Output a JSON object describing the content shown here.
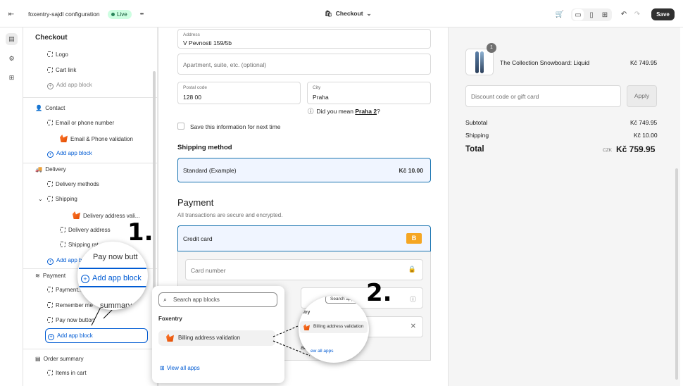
{
  "topbar": {
    "store_name": "foxentry-sajdl configuration",
    "status_badge": "Live",
    "more": "•••",
    "page_selector": "Checkout",
    "save_label": "Save"
  },
  "sidebar": {
    "title": "Checkout",
    "header_items": [
      {
        "label": "Logo"
      },
      {
        "label": "Cart link"
      },
      {
        "label": "Add app block"
      }
    ],
    "contact": {
      "title": "Contact",
      "items": [
        {
          "label": "Email or phone number"
        },
        {
          "label": "Email & Phone validation"
        },
        {
          "label": "Add app block"
        }
      ]
    },
    "delivery": {
      "title": "Delivery",
      "items": [
        {
          "label": "Delivery methods"
        },
        {
          "label": "Shipping"
        },
        {
          "label": "Delivery address vali..."
        },
        {
          "label": "Delivery address"
        },
        {
          "label": "Shipping rat..."
        },
        {
          "label": "Add app b..."
        }
      ]
    },
    "payment": {
      "title": "Payment",
      "items": [
        {
          "label": "Payment..."
        },
        {
          "label": "Remember me"
        },
        {
          "label": "Pay now button"
        },
        {
          "label": "Add app block"
        }
      ]
    },
    "order_summary": {
      "title": "Order summary",
      "items": [
        {
          "label": "Items in cart"
        }
      ]
    }
  },
  "checkout": {
    "address": {
      "label": "Address",
      "value": "V Pevnosti 159/5b"
    },
    "apartment_placeholder": "Apartment, suite, etc. (optional)",
    "postal": {
      "label": "Postal code",
      "value": "128 00"
    },
    "city": {
      "label": "City",
      "value": "Praha"
    },
    "suggest_prefix": "Did you mean",
    "suggest_value": "Praha 2",
    "suggest_suffix": "?",
    "save_info": "Save this information for next time",
    "shipping_title": "Shipping method",
    "shipping_option": "Standard (Example)",
    "shipping_price": "Kč 10.00",
    "payment_title": "Payment",
    "payment_sub": "All transactions are secure and encrypted.",
    "credit_card": "Credit card",
    "card_badge": "B",
    "card_number_ph": "Card number",
    "billing_partial": "address"
  },
  "summary": {
    "item_qty": "1",
    "item_name": "The Collection Snowboard: Liquid",
    "item_price": "Kč 749.95",
    "discount_ph": "Discount code or gift card",
    "apply": "Apply",
    "subtotal_label": "Subtotal",
    "subtotal": "Kč 749.95",
    "shipping_label": "Shipping",
    "shipping": "Kč 10.00",
    "total_label": "Total",
    "currency": "CZK",
    "total": "Kč 759.95"
  },
  "popup": {
    "search_ph": "Search app blocks",
    "group": "Foxentry",
    "block": "Billing address validation",
    "view_all": "View all apps"
  },
  "annotations": {
    "step1": "1.",
    "step2": "2.",
    "lens1_top": "Pay now butt",
    "lens1_btn": "Add app block",
    "lens1_bottom": "summary",
    "lens2_search": "Search app blocks",
    "lens2_group": "ntry",
    "lens2_block": "Billing address validation",
    "lens2_view": "ew all apps"
  }
}
